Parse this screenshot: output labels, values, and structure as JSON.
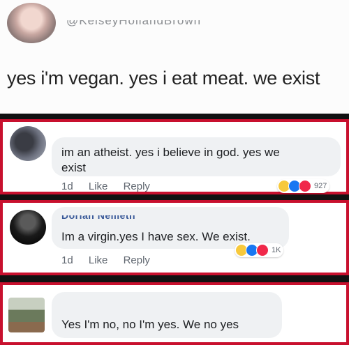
{
  "tweet": {
    "handle": "@KelseyHollandBrown",
    "text": "yes i'm vegan. yes i eat meat. we exist"
  },
  "comments": [
    {
      "text_line1": "im an atheist.  yes i believe in god.  yes we",
      "text_line2": "exist",
      "time": "1d",
      "like": "Like",
      "reply": "Reply",
      "reaction_count": "927",
      "reactions": [
        "haha",
        "like",
        "love"
      ]
    },
    {
      "name": "Dorian Nemeth",
      "text": "Im a virgin.yes I have sex. We exist.",
      "time": "1d",
      "like": "Like",
      "reply": "Reply",
      "reaction_count": "1K",
      "reactions": [
        "haha",
        "like",
        "love"
      ]
    },
    {
      "text": "Yes I'm no, no I'm yes. We no yes"
    }
  ],
  "colors": {
    "frame": "#c8102e",
    "band": "#111111",
    "bubble": "#eff1f3",
    "link": "#385898"
  }
}
